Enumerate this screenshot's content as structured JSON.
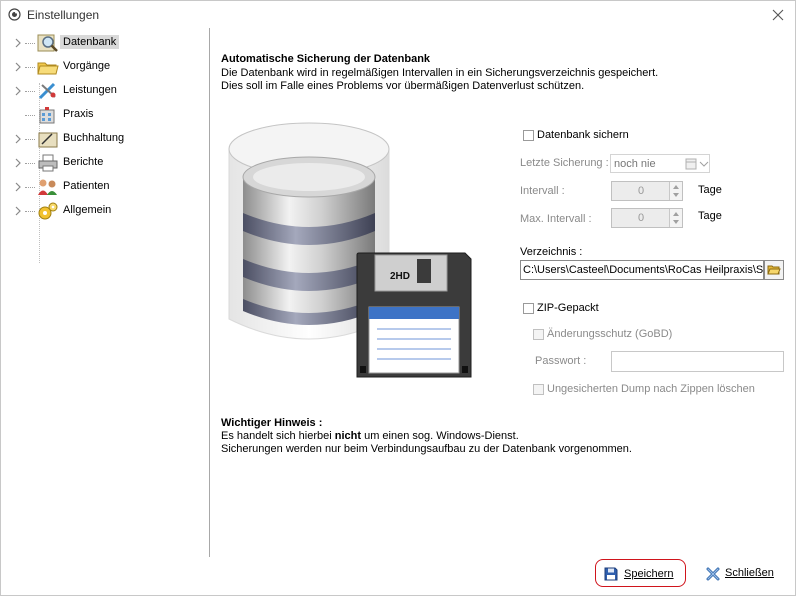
{
  "window": {
    "title": "Einstellungen"
  },
  "tree": {
    "items": [
      {
        "label": "Datenbank",
        "icon": "database-search-icon",
        "selected": true
      },
      {
        "label": "Vorgänge",
        "icon": "folders-icon"
      },
      {
        "label": "Leistungen",
        "icon": "medical-tools-icon"
      },
      {
        "label": "Praxis",
        "icon": "building-icon"
      },
      {
        "label": "Buchhaltung",
        "icon": "ledger-icon"
      },
      {
        "label": "Berichte",
        "icon": "printer-icon"
      },
      {
        "label": "Patienten",
        "icon": "people-icon"
      },
      {
        "label": "Allgemein",
        "icon": "gears-icon"
      }
    ]
  },
  "main": {
    "heading": "Automatische Sicherung der Datenbank",
    "desc1": "Die Datenbank wird in regelmäßigen Intervallen in ein Sicherungsverzeichnis gespeichert.",
    "desc2": "Dies soll im Falle eines Problems vor übermäßigen Datenverlust schützen.",
    "floppy_label": "2HD",
    "backup_checkbox": "Datenbank sichern",
    "last_backup_label": "Letzte Sicherung :",
    "last_backup_value": "noch nie",
    "interval_label": "Intervall :",
    "interval_value": "0",
    "interval_unit": "Tage",
    "max_interval_label": "Max. Intervall :",
    "max_interval_value": "0",
    "max_interval_unit": "Tage",
    "directory_label": "Verzeichnis :",
    "directory_value": "C:\\Users\\Casteel\\Documents\\RoCas Heilpraxis\\Si",
    "zip_label": "ZIP-Gepackt",
    "protect_label": "Änderungsschutz (GoBD)",
    "password_label": "Passwort :",
    "password_value": "",
    "delete_dump_label": "Ungesicherten Dump nach Zippen löschen",
    "notice_heading": "Wichtiger Hinweis :",
    "notice_pre": "Es handelt sich hierbei ",
    "notice_bold": "nicht",
    "notice_post": " um einen sog. Windows-Dienst.",
    "notice_line2": "Sicherungen werden nur beim Verbindungsaufbau zu der Datenbank vorgenommen."
  },
  "footer": {
    "save_label": "Speichern",
    "close_label": "Schließen"
  },
  "colors": {
    "highlight": "#d0141c",
    "selection": "#d9d9d9"
  }
}
